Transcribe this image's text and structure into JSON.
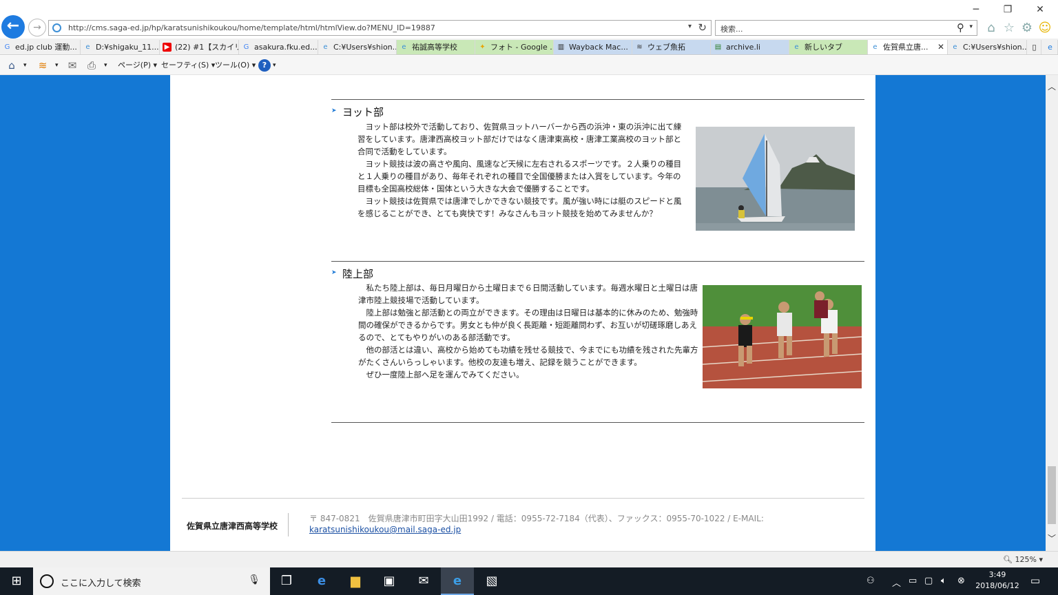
{
  "browser": {
    "url": "http://cms.saga-ed.jp/hp/karatsunishikoukou/home/template/html/htmlView.do?MENU_ID=19887",
    "search_placeholder": "検索...",
    "tabs": [
      {
        "label": "ed.jp club 運動...",
        "icon": "G"
      },
      {
        "label": "D:¥shigaku_11...",
        "icon": "e"
      },
      {
        "label": "(22) #1【スカイリ...",
        "icon": "▶"
      },
      {
        "label": "asakura.fku.ed....",
        "icon": "G"
      },
      {
        "label": "C:¥Users¥shion...",
        "icon": "e"
      },
      {
        "label": "祐誠高等学校",
        "icon": "e"
      },
      {
        "label": "フォト - Google ...",
        "icon": "✦"
      },
      {
        "label": "Wayback Mac...",
        "icon": "▥"
      },
      {
        "label": "ウェブ魚拓",
        "icon": "≋"
      },
      {
        "label": "archive.li",
        "icon": "▤"
      },
      {
        "label": "新しいタブ",
        "icon": "e"
      },
      {
        "label": "佐賀県立唐...",
        "icon": "e"
      },
      {
        "label": "C:¥Users¥shion...",
        "icon": "e"
      }
    ],
    "commands": {
      "page": "ページ(P)",
      "safety": "セーフティ(S)",
      "tools": "ツール(O)"
    },
    "zoom": "125%"
  },
  "content": {
    "yacht": {
      "title": "ヨット部",
      "paragraphs": [
        "　ヨット部は校外で活動しており、佐賀県ヨットハーバーから西の浜沖・東の浜沖に出て練習をしています。唐津西高校ヨット部だけではなく唐津東高校・唐津工業高校のヨット部と合同で活動をしています。",
        "　ヨット競技は波の高さや風向、風速など天候に左右されるスポーツです。２人乗りの種目と１人乗りの種目があり、毎年それぞれの種目で全国優勝または入賞をしています。今年の目標も全国高校総体・国体という大きな大会で優勝することです。",
        "　ヨット競技は佐賀県では唐津でしかできない競技です。風が強い時には艇のスピードと風を感じることができ、とても爽快です！みなさんもヨット競技を始めてみませんか？"
      ]
    },
    "track": {
      "title": "陸上部",
      "paragraphs": [
        "　私たち陸上部は、毎日月曜日から土曜日まで６日間活動しています。毎週水曜日と土曜日は唐津市陸上競技場で活動しています。",
        "　陸上部は勉強と部活動との両立ができます。その理由は日曜日は基本的に休みのため、勉強時間の確保ができるからです。男女とも仲が良く長距離・短距離問わず、お互いが切磋琢磨しあえるので、とてもやりがいのある部活動です。",
        "　他の部活とは違い、高校から始めても功績を残せる競技で、今までにも功績を残された先輩方がたくさんいらっしゃいます。他校の友達も増え、記録を競うことができます。",
        "　ぜひ一度陸上部へ足を運んでみてください。"
      ]
    }
  },
  "footer": {
    "school": "佐賀県立唐津西高等学校",
    "address": "〒 847-0821　佐賀県唐津市町田字大山田1992 / 電話：0955-72-7184（代表）、ファックス：0955-70-1022 / E-MAIL:",
    "email": "karatsunishikoukou@mail.saga-ed.jp"
  },
  "taskbar": {
    "search_placeholder": "ここに入力して検索",
    "time": "3:49",
    "date": "2018/06/12"
  },
  "colors": {
    "page_bg": "#1478d4",
    "accent": "#1f7ad6",
    "taskbar": "#141c25"
  }
}
